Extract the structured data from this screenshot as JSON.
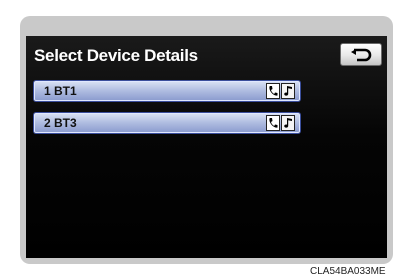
{
  "screen": {
    "title": "Select Device Details",
    "back_button": {
      "icon": "back-arrow-icon"
    }
  },
  "devices": [
    {
      "label": "1  BT1",
      "icons": [
        "phone-icon",
        "music-note-icon"
      ]
    },
    {
      "label": "2  BT3",
      "icons": [
        "phone-icon",
        "music-note-icon"
      ]
    }
  ],
  "caption": "CLA54BA033ME",
  "colors": {
    "screen_background": "#000000",
    "row_highlight": "#aebbe0",
    "frame": "#c9c9c9"
  }
}
